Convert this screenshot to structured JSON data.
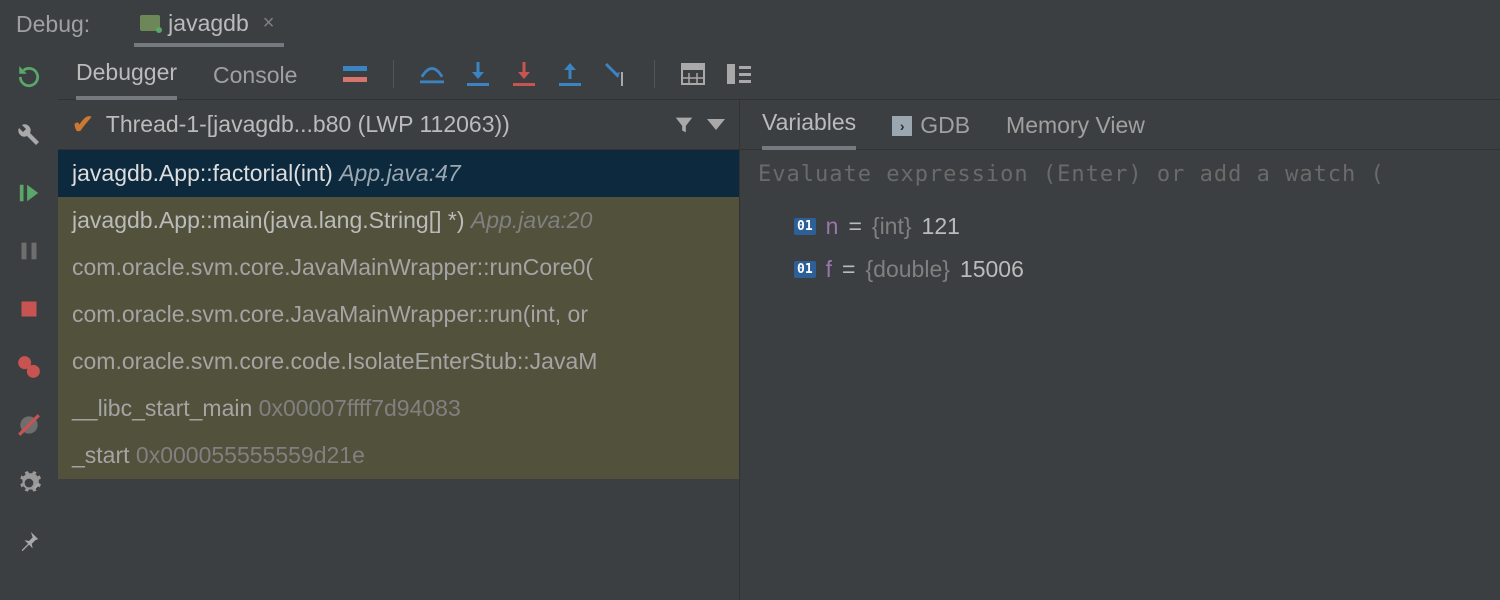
{
  "header": {
    "debug_label": "Debug:",
    "run_config": "javagdb"
  },
  "subtabs": {
    "debugger": "Debugger",
    "console": "Console"
  },
  "thread": {
    "name": "Thread-1-[javagdb...b80 (LWP 112063))"
  },
  "frames": [
    {
      "method": "javagdb.App::factorial(int) ",
      "loc": "App.java:47",
      "selected": true,
      "lib": false
    },
    {
      "method": "javagdb.App::main(java.lang.String[] *) ",
      "loc": "App.java:20",
      "selected": false,
      "lib": false
    },
    {
      "method": "com.oracle.svm.core.JavaMainWrapper::runCore0(",
      "loc": "",
      "selected": false,
      "lib": true
    },
    {
      "method": "com.oracle.svm.core.JavaMainWrapper::run(int, or",
      "loc": "",
      "selected": false,
      "lib": true
    },
    {
      "method": "com.oracle.svm.core.code.IsolateEnterStub::JavaM",
      "loc": "",
      "selected": false,
      "lib": true
    },
    {
      "method": "__libc_start_main ",
      "addr": "0x00007ffff7d94083",
      "selected": false,
      "lib": true
    },
    {
      "method": "_start ",
      "addr": "0x000055555559d21e",
      "selected": false,
      "lib": true
    }
  ],
  "vars_tabs": {
    "variables": "Variables",
    "gdb": "GDB",
    "memory": "Memory View"
  },
  "eval_placeholder": "Evaluate expression (Enter) or add a watch (",
  "variables": [
    {
      "name": "n",
      "type": "{int}",
      "value": "121"
    },
    {
      "name": "f",
      "type": "{double}",
      "value": "15006"
    }
  ]
}
